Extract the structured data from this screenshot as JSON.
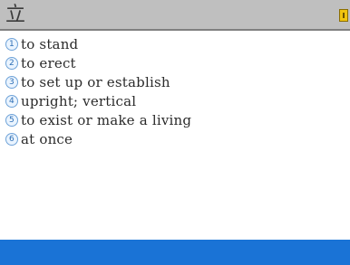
{
  "header": {
    "headword": "立"
  },
  "definitions": [
    {
      "num": "1",
      "text": "to stand"
    },
    {
      "num": "2",
      "text": "to erect"
    },
    {
      "num": "3",
      "text": "to set up or establish"
    },
    {
      "num": "4",
      "text": "upright; vertical"
    },
    {
      "num": "5",
      "text": "to exist or make a living"
    },
    {
      "num": "6",
      "text": "at once"
    }
  ],
  "colors": {
    "titlebar": "#bfbfbf",
    "bottombar": "#1a73d6",
    "number_badge": "#6fa3d8"
  },
  "icons": {
    "corner": "page-icon"
  }
}
